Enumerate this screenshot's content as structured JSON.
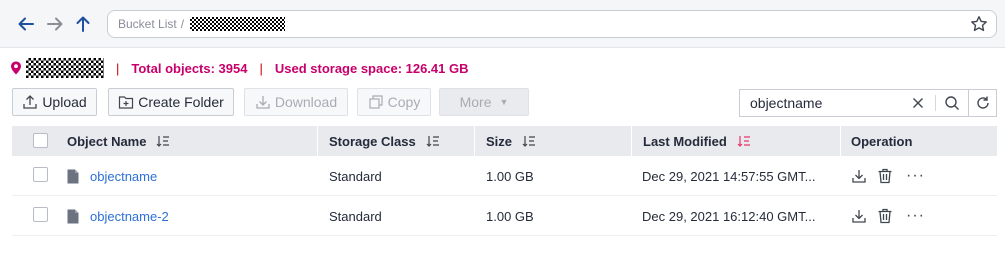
{
  "nav": {
    "back_icon": "arrow-left-icon",
    "forward_icon": "arrow-right-icon",
    "up_icon": "arrow-up-icon",
    "breadcrumb_root": "Bucket List",
    "breadcrumb_sep": "/",
    "favorite_icon": "star-icon"
  },
  "info": {
    "separator": "|",
    "total_objects": "Total objects: 3954",
    "used_storage": "Used storage space: 126.41 GB"
  },
  "toolbar": {
    "upload": "Upload",
    "create_folder": "Create Folder",
    "download": "Download",
    "copy": "Copy",
    "more": "More"
  },
  "search": {
    "value": "objectname"
  },
  "table": {
    "headers": {
      "name": "Object Name",
      "storage_class": "Storage Class",
      "size": "Size",
      "last_modified": "Last Modified",
      "operation": "Operation"
    },
    "rows": [
      {
        "name": "objectname",
        "storage_class": "Standard",
        "size": "1.00 GB",
        "last_modified": "Dec 29, 2021 14:57:55 GMT...",
        "more": "···"
      },
      {
        "name": "objectname-2",
        "storage_class": "Standard",
        "size": "1.00 GB",
        "last_modified": "Dec 29, 2021 16:12:40 GMT...",
        "more": "···"
      }
    ]
  },
  "colors": {
    "accent_red": "#c7000b",
    "accent_magenta": "#c7006b",
    "link_blue": "#2d70d6",
    "active_sort": "#e8366b"
  }
}
